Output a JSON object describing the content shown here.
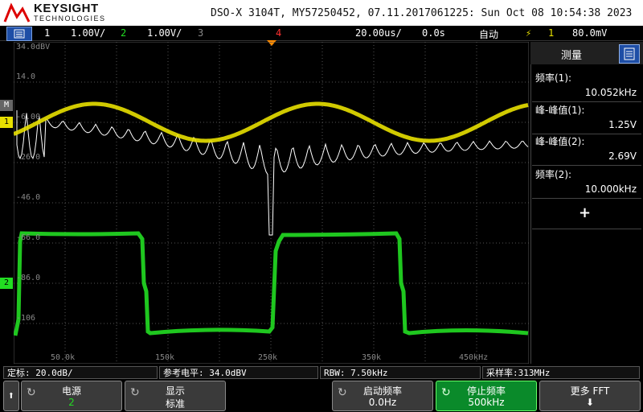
{
  "header": {
    "brand": "KEYSIGHT",
    "brand_sub": "TECHNOLOGIES",
    "title": "DSO-X 3104T, MY57250452, 07.11.2017061225: Sun Oct 08 10:54:38 2023"
  },
  "status_bar": {
    "ch1_num": "1",
    "ch1_scale": "1.00V/",
    "ch2_num": "2",
    "ch2_scale": "1.00V/",
    "ch3_num": "3",
    "ch4_num": "4",
    "timebase": "20.00us/",
    "delay": "0.0s",
    "trigger_mode": "自动",
    "trigger_ch": "1",
    "trigger_level": "80.0mV"
  },
  "grid_labels": {
    "y": [
      "34.0dBV",
      "14.0",
      "-6.00",
      "-26.0",
      "-46.0",
      "-66.0",
      "-86.0",
      "-106"
    ],
    "x": [
      "50.0k",
      "150k",
      "250k",
      "350k",
      "450kHz"
    ]
  },
  "measure_panel": {
    "title": "测量",
    "items": [
      {
        "label": "频率(1):",
        "value": "10.052kHz"
      },
      {
        "label": "峰-峰值(1):",
        "value": "1.25V"
      },
      {
        "label": "峰-峰值(2):",
        "value": "2.69V"
      },
      {
        "label": "频率(2):",
        "value": "10.000kHz"
      }
    ],
    "add": "+"
  },
  "info_bar": {
    "scale": "定标:  20.0dB/",
    "ref_level": "参考电平:  34.0dBV",
    "rbw": "RBW: 7.50kHz",
    "sample_rate": "采样率:313MHz"
  },
  "softkeys": [
    {
      "top": "电源",
      "bottom": "2"
    },
    {
      "top": "显示",
      "bottom": "标准"
    },
    {
      "top": "启动频率",
      "bottom": "0.0Hz"
    },
    {
      "top": "停止频率",
      "bottom": "500kHz"
    },
    {
      "top": "更多 FFT",
      "bottom": "⬇"
    }
  ],
  "colors": {
    "ch1": "#e8e000",
    "ch2": "#22dd22",
    "math": "#ffffff",
    "ch4": "#ff3030"
  }
}
